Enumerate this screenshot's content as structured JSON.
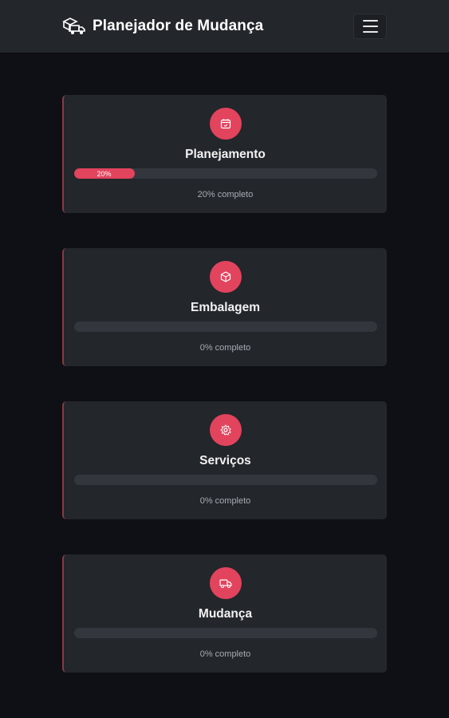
{
  "app": {
    "title": "Planejador de Mudança",
    "accent_color": "#e2435d",
    "menu_icon": "hamburger-menu-icon",
    "brand_icon": "moving-truck-logo-icon"
  },
  "cards": [
    {
      "id": "planejamento",
      "title": "Planejamento",
      "icon": "calendar-icon",
      "progress": 20,
      "progress_label": "20%",
      "status": "20% completo"
    },
    {
      "id": "embalagem",
      "title": "Embalagem",
      "icon": "box-icon",
      "progress": 0,
      "progress_label": "",
      "status": "0% completo"
    },
    {
      "id": "servicos",
      "title": "Serviços",
      "icon": "gear-icon",
      "progress": 0,
      "progress_label": "",
      "status": "0% completo"
    },
    {
      "id": "mudanca",
      "title": "Mudança",
      "icon": "truck-icon",
      "progress": 0,
      "progress_label": "",
      "status": "0% completo"
    }
  ]
}
